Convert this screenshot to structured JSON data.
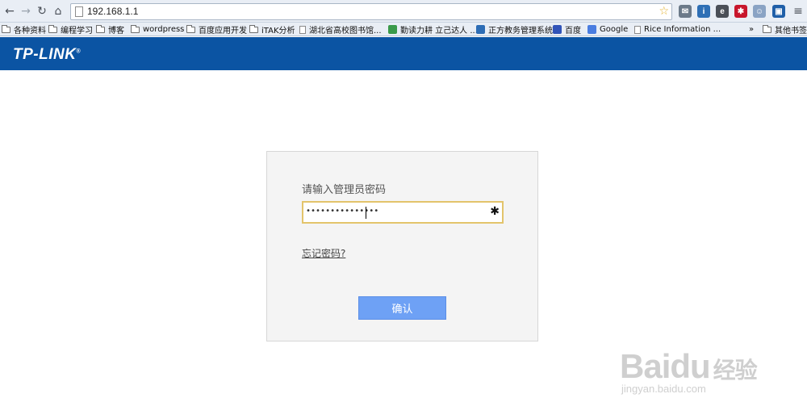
{
  "browser": {
    "url": "192.168.1.1",
    "extensions": [
      {
        "icon": "mail-icon",
        "color": "#6c7a89",
        "glyph": "✉"
      },
      {
        "icon": "ipa-icon",
        "color": "#2e6fb5",
        "glyph": "i"
      },
      {
        "icon": "evernote-icon",
        "color": "#4a4f57",
        "glyph": "e"
      },
      {
        "icon": "red-extension-icon",
        "color": "#c8162c",
        "glyph": "✱"
      },
      {
        "icon": "chat-icon",
        "color": "#8aa3c4",
        "glyph": "☺"
      },
      {
        "icon": "blue-extension-icon",
        "color": "#1f5fa8",
        "glyph": "▣"
      }
    ]
  },
  "bookmarks": [
    {
      "label": "各种资料",
      "type": "folder"
    },
    {
      "label": "编程学习",
      "type": "folder"
    },
    {
      "label": "博客",
      "type": "folder"
    },
    {
      "label": "wordpress",
      "type": "folder"
    },
    {
      "label": "百度应用开发",
      "type": "folder"
    },
    {
      "label": "iTAK分析",
      "type": "folder"
    },
    {
      "label": "湖北省高校图书馆...",
      "type": "page"
    },
    {
      "label": "勤读力耕 立己达人 ...",
      "type": "fav"
    },
    {
      "label": "正方教务管理系统",
      "type": "fav"
    },
    {
      "label": "百度",
      "type": "fav"
    },
    {
      "label": "Google",
      "type": "fav"
    },
    {
      "label": "Rice Information ...",
      "type": "page"
    },
    {
      "label": "其他书签",
      "type": "folder"
    }
  ],
  "header": {
    "logo": "TP-LINK"
  },
  "login": {
    "prompt": "请输入管理员密码",
    "password_masked": "•••••••••••••••",
    "forgot_link": "忘记密码?",
    "confirm_label": "确认"
  },
  "watermark": {
    "brand": "Bai",
    "brand2": "du",
    "suffix": "经验",
    "url": "jingyan.baidu.com"
  },
  "colors": {
    "brand": "#0b54a3",
    "button": "#6ea1f5",
    "field_border": "#e3c46b"
  }
}
